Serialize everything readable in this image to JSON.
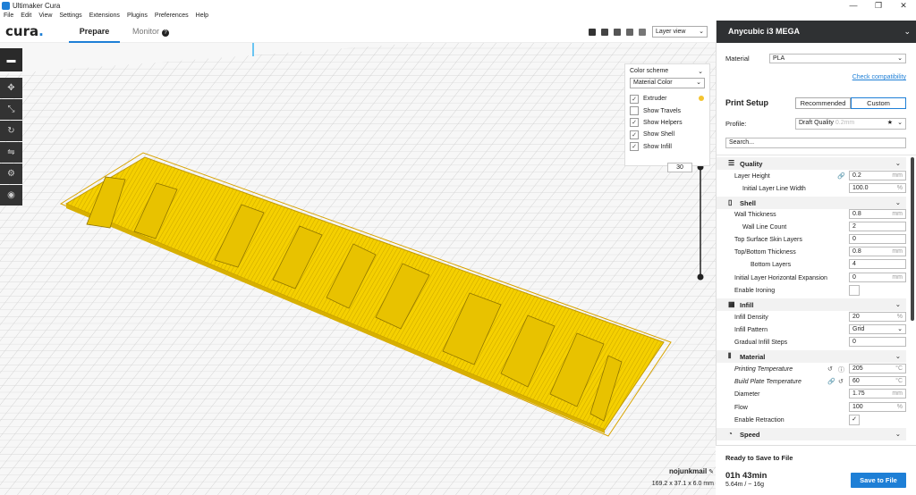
{
  "window": {
    "title": "Ultimaker Cura",
    "controls": [
      "—",
      "❐",
      "✕"
    ]
  },
  "menu": [
    "File",
    "Edit",
    "View",
    "Settings",
    "Extensions",
    "Plugins",
    "Preferences",
    "Help"
  ],
  "header": {
    "logo": "cura",
    "tabs": {
      "prepare": "Prepare",
      "monitor": "Monitor"
    },
    "view_mode": "Layer view"
  },
  "color_scheme": {
    "title": "Color scheme",
    "selected": "Material Color",
    "options": [
      {
        "label": "Extruder",
        "checked": true
      },
      {
        "label": "Show Travels",
        "checked": false
      },
      {
        "label": "Show Helpers",
        "checked": true
      },
      {
        "label": "Show Shell",
        "checked": true
      },
      {
        "label": "Show Infill",
        "checked": true
      }
    ],
    "extruder_color": "#f4c430"
  },
  "layer_slider": {
    "value": "30"
  },
  "model": {
    "text": "NO JUNK MAIL",
    "color": "#f5d000"
  },
  "object_info": {
    "name": "nojunkmail",
    "dimensions": "169.2 x 37.1 x 6.0 mm"
  },
  "sidebar": {
    "machine": "Anycubic i3 MEGA",
    "material_label": "Material",
    "material_value": "PLA",
    "check_compatibility": "Check compatibility",
    "print_setup": "Print Setup",
    "mode_recommended": "Recommended",
    "mode_custom": "Custom",
    "profile_label": "Profile:",
    "profile_value": "Draft Quality",
    "profile_sub": "0.2mm",
    "search_placeholder": "Search...",
    "categories": {
      "quality": "Quality",
      "shell": "Shell",
      "infill": "Infill",
      "material": "Material",
      "speed": "Speed"
    },
    "settings": {
      "layer_height": {
        "label": "Layer Height",
        "value": "0.2",
        "unit": "mm"
      },
      "initial_layer_line_width": {
        "label": "Initial Layer Line Width",
        "value": "100.0",
        "unit": "%"
      },
      "wall_thickness": {
        "label": "Wall Thickness",
        "value": "0.8",
        "unit": "mm"
      },
      "wall_line_count": {
        "label": "Wall Line Count",
        "value": "2",
        "unit": ""
      },
      "top_surface_skin_layers": {
        "label": "Top Surface Skin Layers",
        "value": "0",
        "unit": ""
      },
      "top_bottom_thickness": {
        "label": "Top/Bottom Thickness",
        "value": "0.8",
        "unit": "mm"
      },
      "bottom_layers": {
        "label": "Bottom Layers",
        "value": "4",
        "unit": ""
      },
      "initial_layer_horizontal_expansion": {
        "label": "Initial Layer Horizontal Expansion",
        "value": "0",
        "unit": "mm"
      },
      "enable_ironing": {
        "label": "Enable Ironing",
        "checked": false
      },
      "infill_density": {
        "label": "Infill Density",
        "value": "20",
        "unit": "%"
      },
      "infill_pattern": {
        "label": "Infill Pattern",
        "value": "Grid"
      },
      "gradual_infill_steps": {
        "label": "Gradual Infill Steps",
        "value": "0",
        "unit": ""
      },
      "printing_temperature": {
        "label": "Printing Temperature",
        "value": "205",
        "unit": "°C"
      },
      "build_plate_temperature": {
        "label": "Build Plate Temperature",
        "value": "60",
        "unit": "°C"
      },
      "diameter": {
        "label": "Diameter",
        "value": "1.75",
        "unit": "mm"
      },
      "flow": {
        "label": "Flow",
        "value": "100",
        "unit": "%"
      },
      "enable_retraction": {
        "label": "Enable Retraction",
        "checked": true
      }
    }
  },
  "footer": {
    "status": "Ready to Save to File",
    "time": "01h 43min",
    "usage": "5.64m / ~ 16g",
    "save_button": "Save to File"
  },
  "colors": {
    "accent": "#1e7fd6",
    "dark": "#2f3133"
  }
}
